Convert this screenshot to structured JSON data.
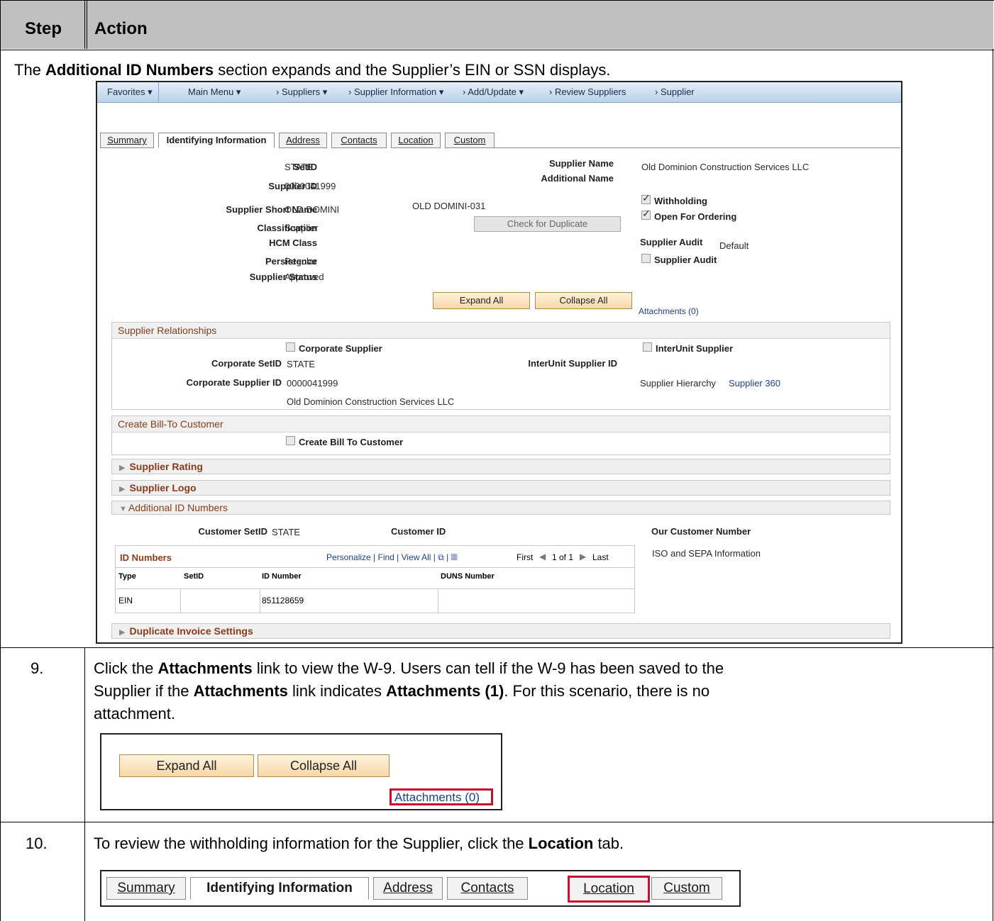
{
  "header": {
    "step": "Step",
    "action": "Action"
  },
  "intro": {
    "pre": "The ",
    "bold": "Additional ID Numbers",
    "post": " section expands and the Supplier’s EIN or SSN displays."
  },
  "nav": {
    "favorites": "Favorites ▾",
    "main_menu": "Main Menu ▾",
    "suppliers": "›   Suppliers ▾",
    "supplier_info": "›   Supplier Information ▾",
    "add_update": "›   Add/Update ▾",
    "review": "›   Review Suppliers",
    "supplier": "›   Supplier"
  },
  "tabs": {
    "summary": "Summary",
    "identifying": "Identifying Information",
    "address": "Address",
    "contacts": "Contacts",
    "location": "Location",
    "custom": "Custom"
  },
  "fields": {
    "setid_label": "SetID",
    "setid_value": "STATE",
    "supplier_id_label": "Supplier ID",
    "supplier_id_value": "0000041999",
    "short_name_label": "Supplier Short Name",
    "short_name_value": "OLD DOMINI",
    "short_name_suffix": "OLD DOMINI-031",
    "classification_label": "Classification",
    "classification_value": "Supplier",
    "hcm_label": "HCM Class",
    "persistence_label": "Persistence",
    "persistence_value": "Regular",
    "status_label": "Supplier Status",
    "status_value": "Approved",
    "supplier_name_label": "Supplier Name",
    "supplier_name_value": "Old Dominion Construction Services LLC",
    "additional_name_label": "Additional Name",
    "withholding": "Withholding",
    "open_for_ordering": "Open For Ordering",
    "check_duplicate": "Check for Duplicate",
    "audit_label": "Supplier Audit",
    "audit_value": "Default",
    "audit_checkbox": "Supplier Audit"
  },
  "buttons": {
    "expand_all": "Expand All",
    "collapse_all": "Collapse All",
    "attachments": "Attachments (0)"
  },
  "relationships": {
    "title": "Supplier Relationships",
    "corporate_supplier": "Corporate Supplier",
    "interunit_supplier": "InterUnit Supplier",
    "corp_setid_label": "Corporate SetID",
    "corp_setid_value": "STATE",
    "interunit_id_label": "InterUnit Supplier ID",
    "corp_supplier_id_label": "Corporate Supplier ID",
    "corp_supplier_id_value": "0000041999",
    "hierarchy": "Supplier Hierarchy",
    "supplier360": "Supplier 360",
    "corp_name": "Old Dominion Construction Services LLC"
  },
  "bill_to": {
    "title": "Create Bill-To Customer",
    "checkbox": "Create Bill To Customer"
  },
  "sections": {
    "rating": "Supplier Rating",
    "logo": "Supplier Logo",
    "additional_ids": "Additional ID Numbers",
    "duplicate_invoice": "Duplicate Invoice Settings"
  },
  "additional": {
    "customer_setid_label": "Customer SetID",
    "customer_setid_value": "STATE",
    "customer_id_label": "Customer ID",
    "our_customer_number": "Our Customer Number",
    "iso_sepa": "ISO and SEPA Information",
    "grid_title": "ID Numbers",
    "grid_tools": "Personalize | Find | View All | ⧉ | ▦",
    "nav_first": "First",
    "nav_count": "1 of 1",
    "nav_last": "Last",
    "columns": [
      "Type",
      "SetID",
      "ID Number",
      "DUNS Number"
    ],
    "row": {
      "type": "EIN",
      "setid": "",
      "id_number": "851128659",
      "duns": ""
    }
  },
  "step9": {
    "number": "9.",
    "line1_pre": "Click the ",
    "line1_b1": "Attachments",
    "line1_post": " link to view the W-9. Users can tell if the W-9 has been saved to the",
    "line2_pre": "Supplier if the ",
    "line2_b1": "Attachments",
    "line2_mid": " link indicates ",
    "line2_b2": "Attachments (1)",
    "line2_post": ". For this scenario, there is no",
    "line3": "attachment."
  },
  "step10": {
    "number": "10.",
    "pre": "To review the withholding information for the Supplier, click the ",
    "bold": "Location",
    "post": " tab."
  }
}
